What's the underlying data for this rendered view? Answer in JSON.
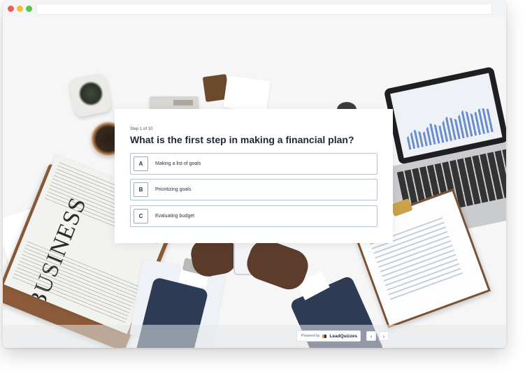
{
  "browser": {
    "window_buttons": [
      "close",
      "minimize",
      "maximize"
    ],
    "url": ""
  },
  "background": {
    "newspaper_headline": "BUSINESS"
  },
  "quiz": {
    "step": "Step 1 of 10",
    "question": "What is the first step in making a financial plan?",
    "options": [
      {
        "letter": "A",
        "label": "Making a list of goals"
      },
      {
        "letter": "B",
        "label": "Prioritizing goals"
      },
      {
        "letter": "C",
        "label": "Evaluating budget"
      }
    ]
  },
  "footer": {
    "powered_by": "Powered by",
    "brand": "LeadQuizzes",
    "prev_icon": "‹",
    "next_icon": "›"
  },
  "colors": {
    "option_border": "#b5c2d6",
    "question_text": "#1f2733",
    "brand_accent": "#f28c28"
  }
}
